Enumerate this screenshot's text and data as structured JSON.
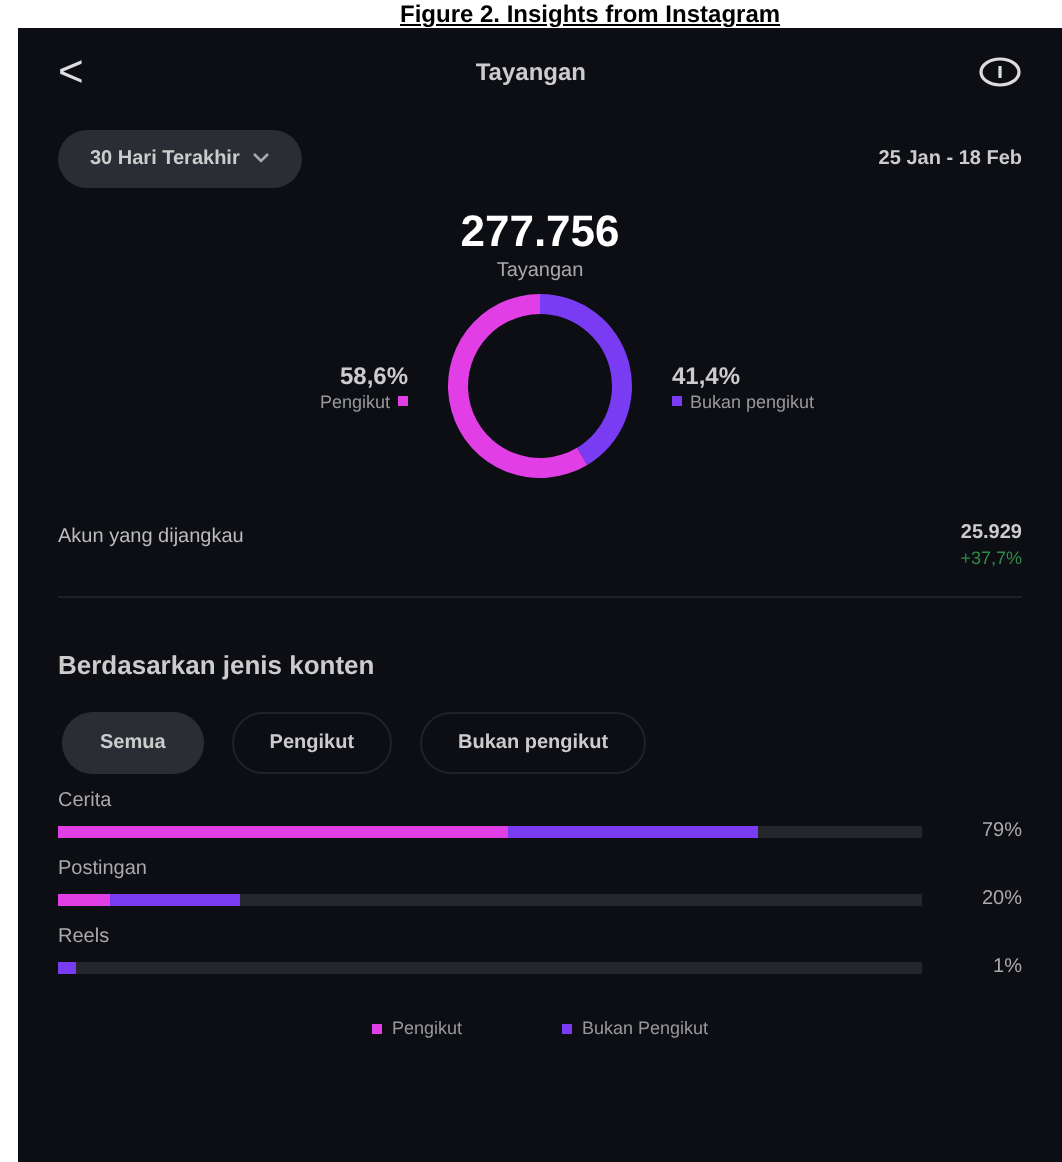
{
  "caption": "Figure 2. Insights from Instagram",
  "header": {
    "back_icon": "<",
    "title": "Tayangan"
  },
  "period": {
    "dropdown": "30 Hari Terakhir",
    "range": "25 Jan - 18 Feb"
  },
  "total": {
    "value": "277.756",
    "label": "Tayangan"
  },
  "split": {
    "chart_data": {
      "type": "donut",
      "categories": [
        "Pengikut",
        "Bukan pengikut"
      ],
      "values": [
        58.6,
        41.4
      ]
    },
    "items": [
      {
        "percent": "58,6%",
        "color": "#e23ee6"
      },
      {
        "percent": "41,4%",
        "color": "#7a3cf2"
      }
    ]
  },
  "reach": {
    "label": "Akun yang dijangkau",
    "value": "25.929",
    "change": "+37,7%"
  },
  "content": {
    "heading": "Berdasarkan jenis konten",
    "filters": [
      {
        "label": "Semua",
        "selected": true
      },
      {
        "label": "Pengikut",
        "selected": false
      },
      {
        "label": "Bukan pengikut",
        "selected": false
      }
    ],
    "rows": [
      {
        "name": "Cerita",
        "percent": "79%",
        "level": 0.81,
        "followers": {
          "level": 0.52
        }
      },
      {
        "name": "Postingan",
        "percent": "20%",
        "level": 0.21,
        "followers": {
          "level": 0.06
        }
      },
      {
        "name": "Reels",
        "percent": "1%",
        "level": 0.02
      }
    ],
    "legend": [
      {
        "label": "Pengikut",
        "color": "#e23ee6"
      },
      {
        "label": "Bukan Pengikut",
        "color": "#7a3cf2"
      }
    ]
  }
}
